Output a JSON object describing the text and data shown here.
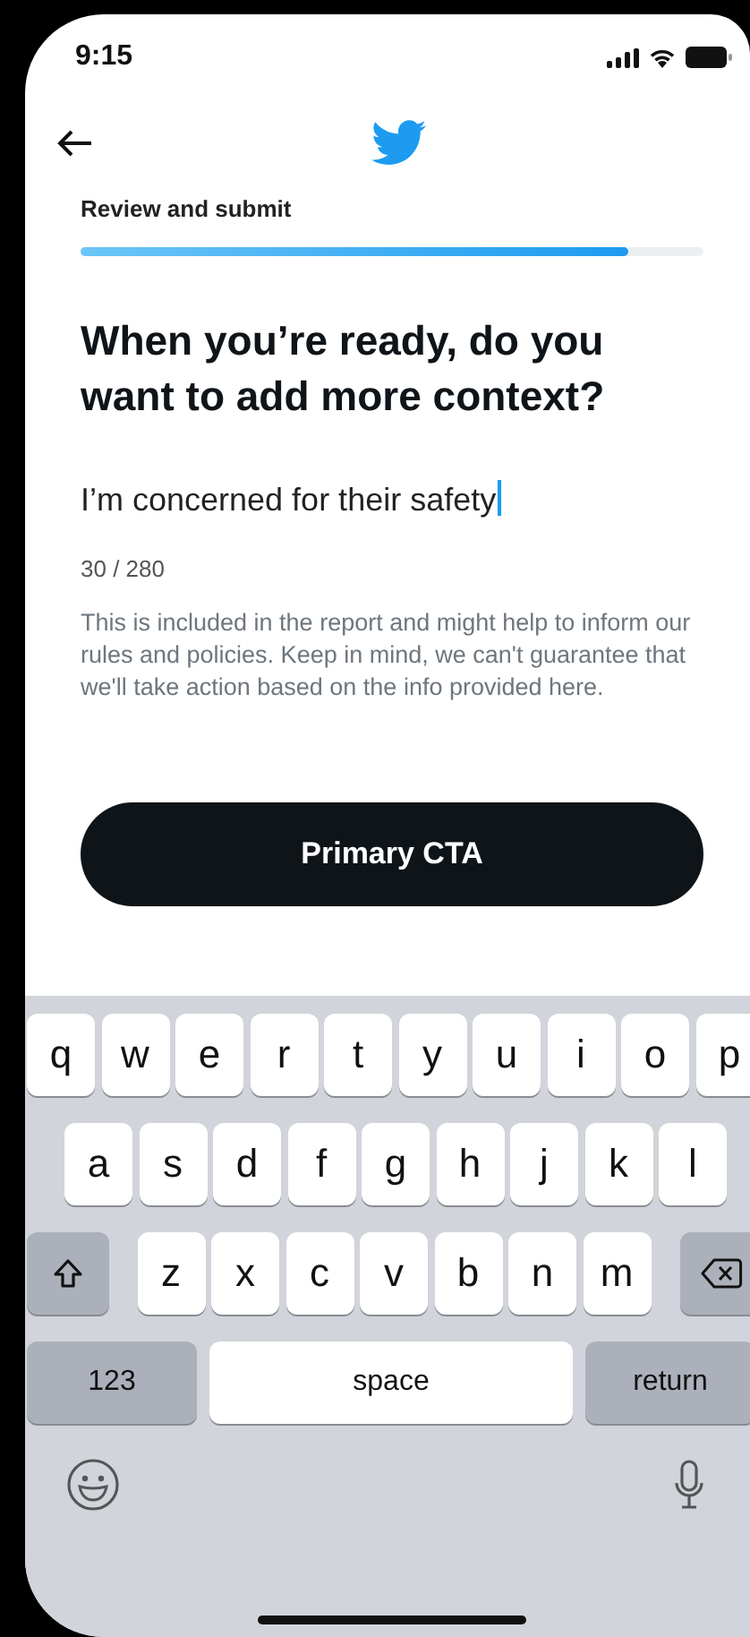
{
  "status_bar": {
    "time": "9:15"
  },
  "header": {
    "step_label": "Review and submit",
    "progress": {
      "level": 0.88
    }
  },
  "heading": "When you’re ready, do you want to add more context?",
  "context_field": {
    "value": "I’m concerned for their safety",
    "focused": true
  },
  "counter": "30 / 280",
  "help_text": "This is included in the report and might help to inform our rules and policies. Keep in mind, we can't guarantee that we'll take action based on the info provided here.",
  "primary_button": {
    "label": "Primary CTA"
  },
  "keyboard": {
    "top_row": [
      {
        "kind": "letter",
        "label": "q"
      },
      {
        "kind": "letter",
        "label": "w"
      },
      {
        "kind": "letter",
        "label": "e"
      },
      {
        "kind": "letter",
        "label": "r"
      },
      {
        "kind": "letter",
        "label": "t"
      },
      {
        "kind": "letter",
        "label": "y"
      },
      {
        "kind": "letter",
        "label": "u"
      },
      {
        "kind": "letter",
        "label": "i"
      },
      {
        "kind": "letter",
        "label": "o"
      },
      {
        "kind": "letter",
        "label": "p"
      }
    ],
    "middle_row": [
      {
        "kind": "letter",
        "label": "a"
      },
      {
        "kind": "letter",
        "label": "s"
      },
      {
        "kind": "letter",
        "label": "d"
      },
      {
        "kind": "letter",
        "label": "f"
      },
      {
        "kind": "letter",
        "label": "g"
      },
      {
        "kind": "letter",
        "label": "h"
      },
      {
        "kind": "letter",
        "label": "j"
      },
      {
        "kind": "letter",
        "label": "k"
      },
      {
        "kind": "letter",
        "label": "l"
      }
    ],
    "lower_row": [
      {
        "kind": "shift"
      },
      {
        "kind": "letter",
        "label": "z"
      },
      {
        "kind": "letter",
        "label": "x"
      },
      {
        "kind": "letter",
        "label": "c"
      },
      {
        "kind": "letter",
        "label": "v"
      },
      {
        "kind": "letter",
        "label": "b"
      },
      {
        "kind": "letter",
        "label": "n"
      },
      {
        "kind": "letter",
        "label": "m"
      },
      {
        "kind": "delete"
      }
    ],
    "function_row": [
      {
        "kind": "mode",
        "label": "123"
      },
      {
        "kind": "space",
        "label": "space"
      },
      {
        "kind": "return",
        "label": "return"
      }
    ]
  }
}
